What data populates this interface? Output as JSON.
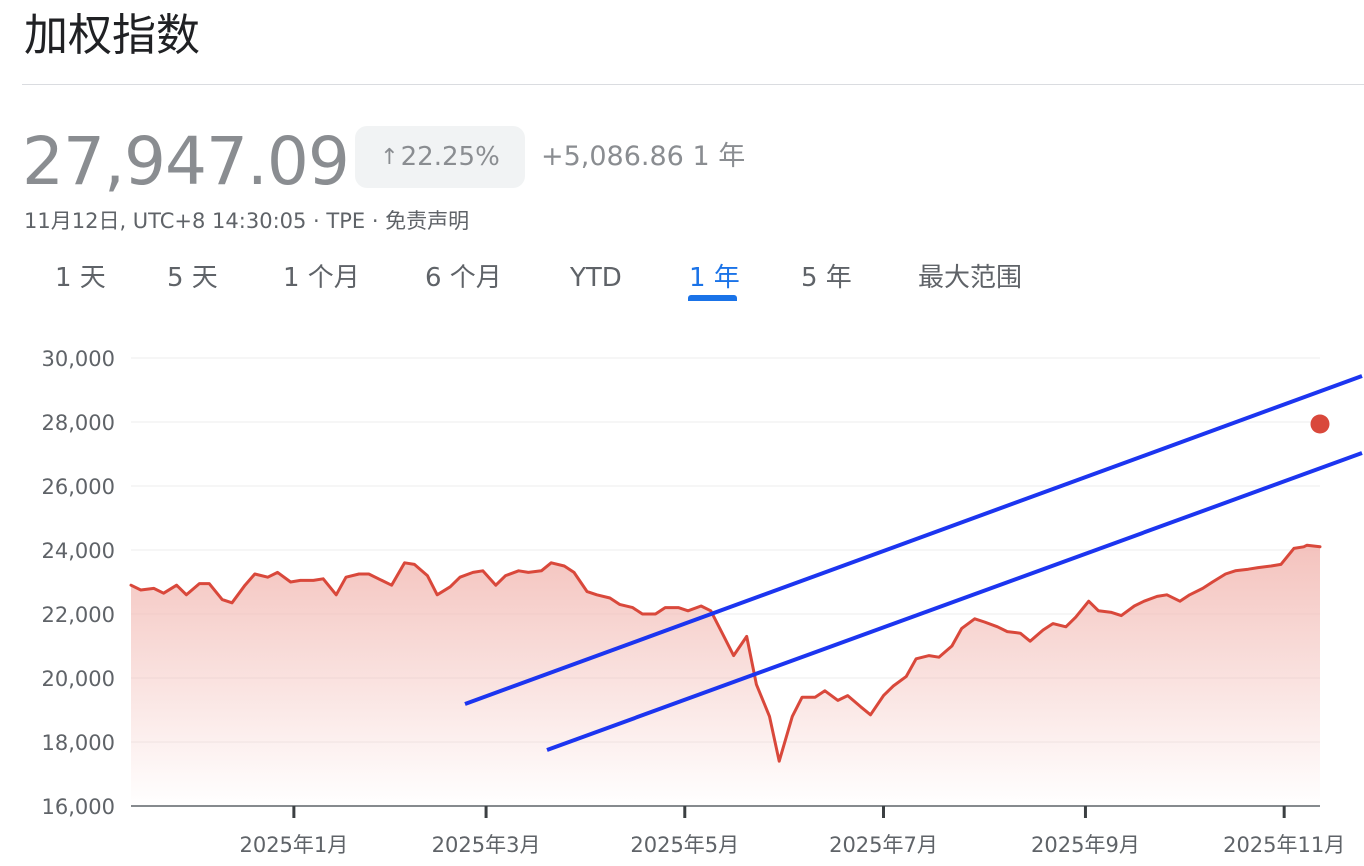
{
  "header": {
    "title": "加权指数"
  },
  "quote": {
    "price": "27,947.09",
    "change_arrow": "↑",
    "change_pct": "22.25%",
    "change_abs": "+5,086.86 1 年",
    "meta": "11月12日, UTC+8 14:30:05 · TPE · 免责声明"
  },
  "tabs": [
    {
      "label": "1 天",
      "active": false
    },
    {
      "label": "5 天",
      "active": false
    },
    {
      "label": "1 个月",
      "active": false
    },
    {
      "label": "6 个月",
      "active": false
    },
    {
      "label": "YTD",
      "active": false
    },
    {
      "label": "1 年",
      "active": true
    },
    {
      "label": "5 年",
      "active": false
    },
    {
      "label": "最大范围",
      "active": false
    }
  ],
  "colors": {
    "line": "#d9483b",
    "fill_top": "#f2b8b2",
    "channel": "#1c35f0",
    "active_tab": "#1a73e8"
  },
  "chart_data": {
    "type": "area",
    "ylim": [
      16000,
      30000
    ],
    "xlim": [
      "2024-11-12",
      "2025-11-12"
    ],
    "y_ticks": [
      {
        "label": "30,000",
        "value": 30000
      },
      {
        "label": "28,000",
        "value": 28000
      },
      {
        "label": "26,000",
        "value": 26000
      },
      {
        "label": "24,000",
        "value": 24000
      },
      {
        "label": "22,000",
        "value": 22000
      },
      {
        "label": "20,000",
        "value": 20000
      },
      {
        "label": "18,000",
        "value": 18000
      },
      {
        "label": "16,000",
        "value": 16000
      }
    ],
    "x_ticks": [
      {
        "label": "2025年1月",
        "date": "2025-01-01"
      },
      {
        "label": "2025年3月",
        "date": "2025-03-01"
      },
      {
        "label": "2025年5月",
        "date": "2025-05-01"
      },
      {
        "label": "2025年7月",
        "date": "2025-07-01"
      },
      {
        "label": "2025年9月",
        "date": "2025-09-01"
      },
      {
        "label": "2025年11月",
        "date": "2025-11-01"
      }
    ],
    "grid": true,
    "series": [
      {
        "points": [
          [
            "2024-11-12",
            22900
          ],
          [
            "2024-11-15",
            22750
          ],
          [
            "2024-11-19",
            22800
          ],
          [
            "2024-11-22",
            22650
          ],
          [
            "2024-11-26",
            22900
          ],
          [
            "2024-11-29",
            22600
          ],
          [
            "2024-12-03",
            22950
          ],
          [
            "2024-12-06",
            22950
          ],
          [
            "2024-12-10",
            22450
          ],
          [
            "2024-12-13",
            22350
          ],
          [
            "2024-12-17",
            22900
          ],
          [
            "2024-12-20",
            23250
          ],
          [
            "2024-12-24",
            23150
          ],
          [
            "2024-12-27",
            23300
          ],
          [
            "2024-12-31",
            23000
          ],
          [
            "2025-01-03",
            23050
          ],
          [
            "2025-01-07",
            23050
          ],
          [
            "2025-01-10",
            23100
          ],
          [
            "2025-01-14",
            22600
          ],
          [
            "2025-01-17",
            23150
          ],
          [
            "2025-01-21",
            23250
          ],
          [
            "2025-01-24",
            23250
          ],
          [
            "2025-01-28",
            23050
          ],
          [
            "2025-01-31",
            22900
          ],
          [
            "2025-02-04",
            23600
          ],
          [
            "2025-02-07",
            23550
          ],
          [
            "2025-02-11",
            23200
          ],
          [
            "2025-02-14",
            22600
          ],
          [
            "2025-02-18",
            22850
          ],
          [
            "2025-02-21",
            23150
          ],
          [
            "2025-02-25",
            23300
          ],
          [
            "2025-02-28",
            23350
          ],
          [
            "2025-03-04",
            22900
          ],
          [
            "2025-03-07",
            23200
          ],
          [
            "2025-03-11",
            23350
          ],
          [
            "2025-03-14",
            23300
          ],
          [
            "2025-03-18",
            23350
          ],
          [
            "2025-03-21",
            23600
          ],
          [
            "2025-03-25",
            23500
          ],
          [
            "2025-03-28",
            23300
          ],
          [
            "2025-04-01",
            22700
          ],
          [
            "2025-04-04",
            22600
          ],
          [
            "2025-04-08",
            22500
          ],
          [
            "2025-04-11",
            22300
          ],
          [
            "2025-04-15",
            22200
          ],
          [
            "2025-04-18",
            22000
          ],
          [
            "2025-04-22",
            22000
          ],
          [
            "2025-04-25",
            22200
          ],
          [
            "2025-04-29",
            22200
          ],
          [
            "2025-05-02",
            22100
          ],
          [
            "2025-05-06",
            22250
          ],
          [
            "2025-05-09",
            22100
          ],
          [
            "2025-05-13",
            21300
          ],
          [
            "2025-05-16",
            20700
          ],
          [
            "2025-05-20",
            21300
          ],
          [
            "2025-05-23",
            19800
          ],
          [
            "2025-05-27",
            18800
          ],
          [
            "2025-05-30",
            17400
          ],
          [
            "2025-06-03",
            18800
          ],
          [
            "2025-06-06",
            19400
          ],
          [
            "2025-06-10",
            19400
          ],
          [
            "2025-06-13",
            19600
          ],
          [
            "2025-06-17",
            19300
          ],
          [
            "2025-06-20",
            19450
          ],
          [
            "2025-06-24",
            19100
          ],
          [
            "2025-06-27",
            18850
          ],
          [
            "2025-07-01",
            19450
          ],
          [
            "2025-07-04",
            19750
          ],
          [
            "2025-07-08",
            20050
          ],
          [
            "2025-07-11",
            20600
          ],
          [
            "2025-07-15",
            20700
          ],
          [
            "2025-07-18",
            20650
          ],
          [
            "2025-07-22",
            21000
          ],
          [
            "2025-07-25",
            21550
          ],
          [
            "2025-07-29",
            21850
          ],
          [
            "2025-08-01",
            21750
          ],
          [
            "2025-08-05",
            21600
          ],
          [
            "2025-08-08",
            21450
          ],
          [
            "2025-08-12",
            21400
          ],
          [
            "2025-08-15",
            21150
          ],
          [
            "2025-08-19",
            21500
          ],
          [
            "2025-08-22",
            21700
          ],
          [
            "2025-08-26",
            21600
          ],
          [
            "2025-08-29",
            21900
          ],
          [
            "2025-09-02",
            22400
          ],
          [
            "2025-09-05",
            22100
          ],
          [
            "2025-09-09",
            22050
          ],
          [
            "2025-09-12",
            21950
          ],
          [
            "2025-09-16",
            22250
          ],
          [
            "2025-09-19",
            22400
          ],
          [
            "2025-09-23",
            22550
          ],
          [
            "2025-09-26",
            22600
          ],
          [
            "2025-09-30",
            22400
          ],
          [
            "2025-10-03",
            22600
          ],
          [
            "2025-10-07",
            22800
          ],
          [
            "2025-10-10",
            23000
          ],
          [
            "2025-10-14",
            23250
          ],
          [
            "2025-10-17",
            23350
          ],
          [
            "2025-10-21",
            23400
          ],
          [
            "2025-10-24",
            23450
          ],
          [
            "2025-10-28",
            23500
          ],
          [
            "2025-10-31",
            23550
          ],
          [
            "2025-11-04",
            24050
          ],
          [
            "2025-11-07",
            24100
          ],
          [
            "2025-11-08",
            24150
          ],
          [
            "2025-11-12",
            24100
          ]
        ]
      }
    ]
  }
}
